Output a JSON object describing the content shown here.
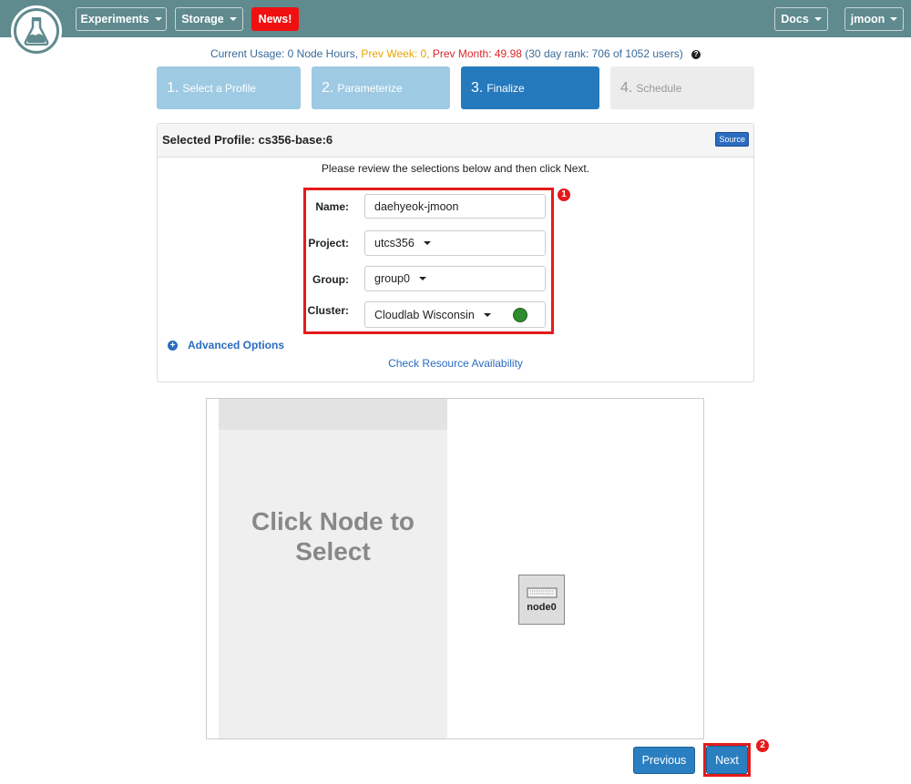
{
  "nav": {
    "experiments": "Experiments",
    "storage": "Storage",
    "news": "News!",
    "docs": "Docs",
    "user": "jmoon"
  },
  "usage": {
    "current": "Current Usage: 0 Node Hours,",
    "prev_week": "Prev Week: 0,",
    "prev_month": "Prev Month: 49.98",
    "rank": "(30 day rank: 706 of 1052 users)",
    "help_icon": "?"
  },
  "steps": [
    {
      "num": "1.",
      "label": "Select a Profile"
    },
    {
      "num": "2.",
      "label": "Parameterize"
    },
    {
      "num": "3.",
      "label": "Finalize"
    },
    {
      "num": "4.",
      "label": "Schedule"
    }
  ],
  "panel": {
    "title": "Selected Profile: cs356-base:6",
    "source": "Source",
    "instructions": "Please review the selections below and then click Next."
  },
  "form": {
    "name_label": "Name:",
    "name_value": "daehyeok-jmoon",
    "project_label": "Project:",
    "project_value": "utcs356",
    "group_label": "Group:",
    "group_value": "group0",
    "cluster_label": "Cluster:",
    "cluster_value": "Cloudlab Wisconsin",
    "cluster_status_color": "#2e8b2e"
  },
  "annotations": {
    "badge1": "1",
    "badge2": "2",
    "highlight_color": "#e41b1b"
  },
  "advanced_options": "Advanced Options",
  "check_availability": "Check Resource Availability",
  "topology": {
    "placeholder": "Click Node to Select",
    "node_label": "node0"
  },
  "buttons": {
    "previous": "Previous",
    "next": "Next"
  },
  "colors": {
    "navbar": "#5f8a8e",
    "primary": "#2a7fc1",
    "step_done": "#9ecae3",
    "step_active": "#2579bd"
  }
}
